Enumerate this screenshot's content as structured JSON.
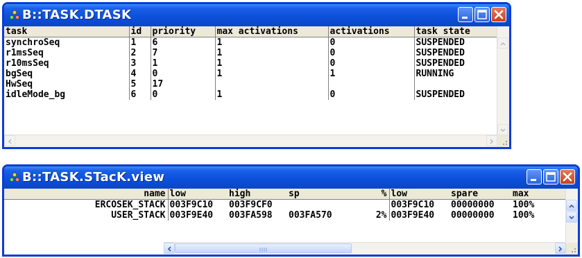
{
  "windows": [
    {
      "title": "B::TASK.DTASK",
      "columns": [
        "task",
        "id",
        "priority",
        "max activations",
        "activations",
        "task state"
      ],
      "rows": [
        [
          "synchroSeq",
          "1",
          "6",
          "1",
          "0",
          "SUSPENDED"
        ],
        [
          "r1msSeq",
          "2",
          "7",
          "1",
          "0",
          "SUSPENDED"
        ],
        [
          "r10msSeq",
          "3",
          "1",
          "1",
          "0",
          "SUSPENDED"
        ],
        [
          "bgSeq",
          "4",
          "0",
          "1",
          "1",
          "RUNNING"
        ],
        [
          "HwSeq",
          "5",
          "17",
          "",
          "",
          ""
        ],
        [
          "idleMode_bg",
          "6",
          "0",
          "1",
          "0",
          "SUSPENDED"
        ]
      ]
    },
    {
      "title": "B::TASK.STacK.view",
      "columns": [
        "name",
        "low",
        "high",
        "sp",
        "%",
        "low",
        "spare",
        "max"
      ],
      "rows": [
        [
          "ERCOSEK_STACK",
          "003F9C10",
          "003F9CF0",
          "",
          "",
          "003F9C10",
          "00000000",
          "100%"
        ],
        [
          "USER_STACK",
          "003F9E40",
          "003FA598",
          "003FA570",
          "2%",
          "003F9E40",
          "00000000",
          "100%"
        ]
      ]
    }
  ],
  "colors": {
    "title_bar": "#0b4fd9",
    "window_border": "#0a3cd8",
    "close_button": "#c8401e",
    "header_bg": "#ece9d8"
  },
  "icons": [
    "app-icon",
    "minimize-icon",
    "maximize-icon",
    "close-icon",
    "scroll-up-icon",
    "scroll-down-icon",
    "scroll-left-icon",
    "scroll-right-icon",
    "resize-grip-icon"
  ]
}
